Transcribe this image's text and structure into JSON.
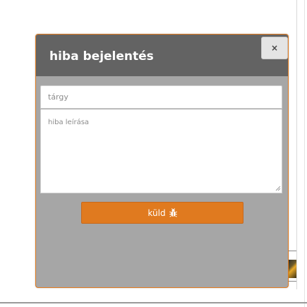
{
  "dialog": {
    "title": "hiba bejelentés",
    "close_label": "×"
  },
  "form": {
    "subject_placeholder": "tárgy",
    "subject_value": "",
    "description_placeholder": "hiba leírása",
    "description_value": ""
  },
  "submit": {
    "label": "küld",
    "icon": "bug-icon"
  },
  "colors": {
    "accent": "#e07a1f",
    "header_bg": "#636363",
    "body_bg": "#a6a6a6"
  }
}
